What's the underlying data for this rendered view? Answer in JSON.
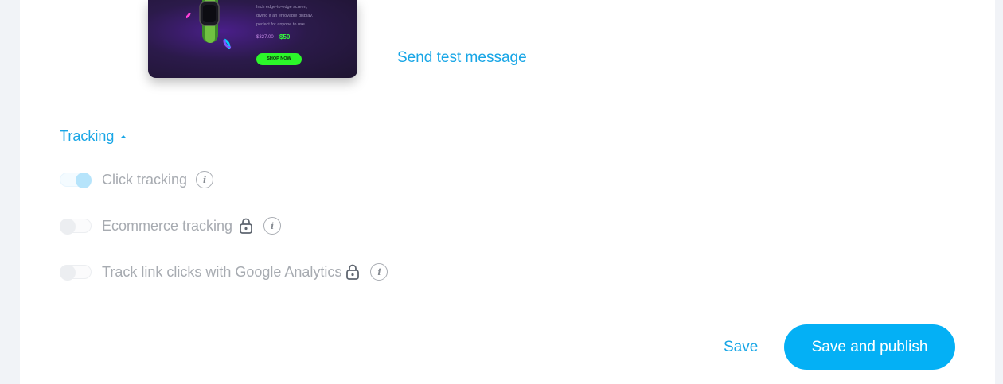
{
  "preview": {
    "copy_lines": [
      "Inch edge-to-edge screen,",
      "giving it an enjoyable display,",
      "perfect for anyone to use."
    ],
    "old_price": "$327.00",
    "new_price": "$50",
    "shop_button": "SHOP NOW"
  },
  "send_test_label": "Send test message",
  "tracking": {
    "title": "Tracking",
    "options": [
      {
        "label": "Click tracking",
        "enabled": true,
        "locked": false
      },
      {
        "label": "Ecommerce tracking",
        "enabled": false,
        "locked": true
      },
      {
        "label": "Track link clicks with Google Analytics",
        "enabled": false,
        "locked": true
      }
    ]
  },
  "actions": {
    "save_label": "Save",
    "publish_label": "Save and publish"
  },
  "colors": {
    "accent": "#18a6e6",
    "primary_button": "#04b0f5",
    "muted_text": "#a7abb1"
  },
  "icons": {
    "lock": "lock-icon",
    "info": "info-icon",
    "caret": "caret-up-icon"
  }
}
